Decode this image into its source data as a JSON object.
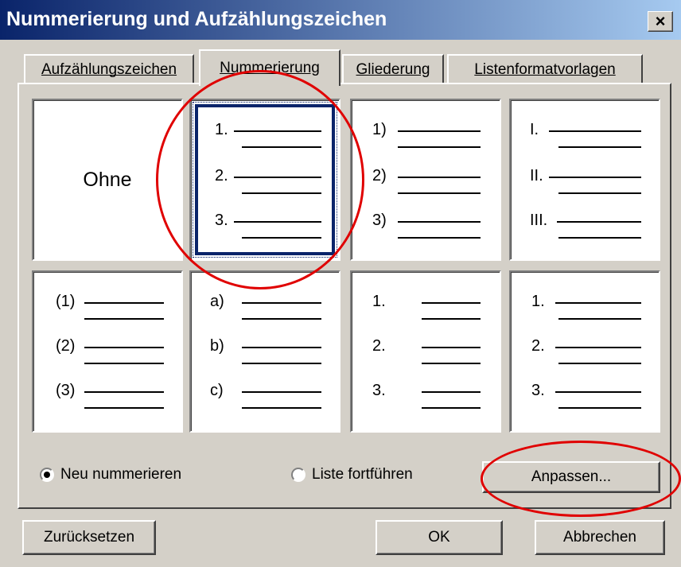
{
  "window": {
    "title": "Nummerierung und Aufzählungszeichen",
    "close_glyph": "×"
  },
  "tabs": [
    {
      "label": "Aufzählungszeichen",
      "active": false
    },
    {
      "label": "Nummerierung",
      "active": true
    },
    {
      "label": "Gliederung",
      "active": false
    },
    {
      "label": "Listenformatvorlagen",
      "active": false
    }
  ],
  "gallery": {
    "none_label": "Ohne",
    "formats": [
      {
        "markers": [
          "1.",
          "2.",
          "3."
        ],
        "selected": true
      },
      {
        "markers": [
          "1)",
          "2)",
          "3)"
        ]
      },
      {
        "markers": [
          "I.",
          "II.",
          "III."
        ]
      },
      {
        "markers": [
          "(1)",
          "(2)",
          "(3)"
        ]
      },
      {
        "markers": [
          "a)",
          "b)",
          "c)"
        ]
      },
      {
        "markers": [
          "1.",
          "2.",
          "3."
        ]
      },
      {
        "markers": [
          "1.",
          "2.",
          "3."
        ]
      }
    ]
  },
  "options": {
    "renumber_label": "Neu nummerieren",
    "renumber_checked": true,
    "continue_label": "Liste fortführen",
    "continue_checked": false
  },
  "buttons": {
    "customize": "Anpassen...",
    "reset": "Zurücksetzen",
    "ok": "OK",
    "cancel": "Abbrechen"
  },
  "colors": {
    "titlebar": "#0a246a",
    "highlight_circle": "#e00000",
    "dialog_bg": "#d4d0c8"
  }
}
